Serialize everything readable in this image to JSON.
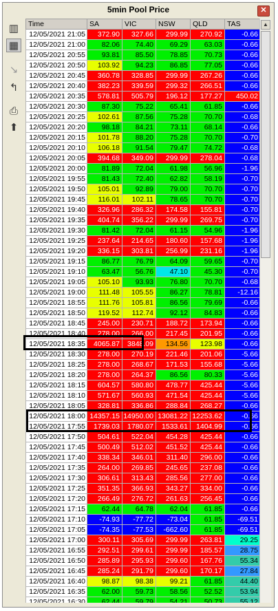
{
  "window": {
    "title": "5min Pool Price",
    "close_label": "✕"
  },
  "toolbar": {
    "items": [
      {
        "name": "chart-icon",
        "glyph": "▥"
      },
      {
        "name": "grid-icon",
        "glyph": "▦"
      },
      {
        "name": "export-icon",
        "glyph": "↘"
      },
      {
        "name": "return-icon",
        "glyph": "↰"
      },
      {
        "name": "printer-icon",
        "glyph": "⎙"
      },
      {
        "name": "paste-icon",
        "glyph": "⬆"
      }
    ]
  },
  "table": {
    "headers": [
      "Time",
      "SA",
      "VIC",
      "NSW",
      "QLD",
      "TAS"
    ],
    "rows": [
      [
        "12/05/2021 21:05",
        "372.90",
        "327.66",
        "299.99",
        "270.92",
        "-0.66"
      ],
      [
        "12/05/2021 21:00",
        "82.06",
        "74.40",
        "69.29",
        "63.03",
        "-0.66"
      ],
      [
        "12/05/2021 20:55",
        "93.81",
        "85.50",
        "78.85",
        "70.73",
        "-0.66"
      ],
      [
        "12/05/2021 20:50",
        "103.92",
        "94.23",
        "86.85",
        "77.05",
        "-0.66"
      ],
      [
        "12/05/2021 20:45",
        "360.78",
        "328.85",
        "299.99",
        "267.26",
        "-0.66"
      ],
      [
        "12/05/2021 20:40",
        "382.23",
        "339.59",
        "299.32",
        "266.51",
        "-0.66"
      ],
      [
        "12/05/2021 20:35",
        "578.81",
        "505.79",
        "196.12",
        "177.27",
        "450.02"
      ],
      [
        "12/05/2021 20:30",
        "87.30",
        "75.22",
        "65.41",
        "61.85",
        "-0.66"
      ],
      [
        "12/05/2021 20:25",
        "102.61",
        "87.56",
        "75.28",
        "70.70",
        "-0.68"
      ],
      [
        "12/05/2021 20:20",
        "98.18",
        "84.21",
        "73.11",
        "68.14",
        "-0.66"
      ],
      [
        "12/05/2021 20:15",
        "101.78",
        "88.20",
        "75.28",
        "70.70",
        "-0.70"
      ],
      [
        "12/05/2021 20:10",
        "106.18",
        "91.54",
        "79.47",
        "74.72",
        "-0.68"
      ],
      [
        "12/05/2021 20:05",
        "394.68",
        "349.09",
        "299.99",
        "278.04",
        "-0.68"
      ],
      [
        "12/05/2021 20:00",
        "81.89",
        "72.04",
        "61.98",
        "56.96",
        "-1.96"
      ],
      [
        "12/05/2021 19:55",
        "81.43",
        "72.40",
        "62.82",
        "58.19",
        "-0.70"
      ],
      [
        "12/05/2021 19:50",
        "105.01",
        "92.89",
        "79.00",
        "70.70",
        "-0.70"
      ],
      [
        "12/05/2021 19:45",
        "116.01",
        "102.11",
        "78.65",
        "70.70",
        "-0.70"
      ],
      [
        "12/05/2021 19:40",
        "326.96",
        "286.32",
        "174.58",
        "155.81",
        "-0.70"
      ],
      [
        "12/05/2021 19:35",
        "404.74",
        "356.22",
        "299.99",
        "269.75",
        "-0.70"
      ],
      [
        "12/05/2021 19:30",
        "81.42",
        "72.04",
        "61.15",
        "54.96",
        "-1.96"
      ],
      [
        "12/05/2021 19:25",
        "237.64",
        "214.65",
        "180.60",
        "157.68",
        "-1.96"
      ],
      [
        "12/05/2021 19:20",
        "336.15",
        "303.81",
        "256.99",
        "231.16",
        "-1.96"
      ],
      [
        "12/05/2021 19:15",
        "86.77",
        "76.79",
        "64.09",
        "59.65",
        "-0.70"
      ],
      [
        "12/05/2021 19:10",
        "63.47",
        "56.76",
        "47.10",
        "45.30",
        "-0.70"
      ],
      [
        "12/05/2021 19:05",
        "105.10",
        "93.93",
        "76.80",
        "70.70",
        "-0.68"
      ],
      [
        "12/05/2021 19:00",
        "111.48",
        "105.55",
        "86.27",
        "78.81",
        "-12.16"
      ],
      [
        "12/05/2021 18:55",
        "111.76",
        "105.81",
        "86.56",
        "79.69",
        "-0.66"
      ],
      [
        "12/05/2021 18:50",
        "119.52",
        "112.74",
        "92.12",
        "84.83",
        "-0.66"
      ],
      [
        "12/05/2021 18:45",
        "245.00",
        "230.71",
        "188.72",
        "173.94",
        "-0.66"
      ],
      [
        "12/05/2021 18:40",
        "278.00",
        "266.00",
        "217.45",
        "201.95",
        "-0.66"
      ],
      [
        "12/05/2021 18:35",
        "4065.87",
        "3848.09",
        "134.56",
        "123.98",
        "-0.66"
      ],
      [
        "12/05/2021 18:30",
        "278.00",
        "270.19",
        "221.46",
        "201.06",
        "-5.66"
      ],
      [
        "12/05/2021 18:25",
        "278.00",
        "268.67",
        "171.53",
        "155.68",
        "-5.66"
      ],
      [
        "12/05/2021 18:20",
        "278.00",
        "264.37",
        "86.56",
        "80.33",
        "-5.66"
      ],
      [
        "12/05/2021 18:15",
        "604.57",
        "580.80",
        "478.77",
        "425.44",
        "-5.66"
      ],
      [
        "12/05/2021 18:10",
        "571.67",
        "560.93",
        "471.54",
        "425.44",
        "-5.66"
      ],
      [
        "12/05/2021 18:05",
        "328.81",
        "336.86",
        "288.84",
        "268.27",
        "-0.66"
      ],
      [
        "12/05/2021 18:00",
        "14357.15",
        "14950.00",
        "13081.22",
        "12253.62",
        "-0.66"
      ],
      [
        "12/05/2021 17:55",
        "1739.03",
        "1780.07",
        "1533.61",
        "1404.99",
        "-0.66"
      ],
      [
        "12/05/2021 17:50",
        "504.61",
        "522.04",
        "454.28",
        "425.44",
        "-0.66"
      ],
      [
        "12/05/2021 17:45",
        "500.49",
        "512.02",
        "451.52",
        "425.44",
        "-0.66"
      ],
      [
        "12/05/2021 17:40",
        "338.34",
        "346.01",
        "311.40",
        "296.00",
        "-0.66"
      ],
      [
        "12/05/2021 17:35",
        "264.00",
        "269.85",
        "245.65",
        "237.08",
        "-0.66"
      ],
      [
        "12/05/2021 17:30",
        "306.61",
        "313.43",
        "285.56",
        "277.00",
        "-0.66"
      ],
      [
        "12/05/2021 17:25",
        "351.35",
        "366.93",
        "343.27",
        "334.00",
        "-0.66"
      ],
      [
        "12/05/2021 17:20",
        "266.49",
        "276.72",
        "261.63",
        "256.45",
        "-0.66"
      ],
      [
        "12/05/2021 17:15",
        "62.44",
        "64.78",
        "62.04",
        "61.85",
        "-0.66"
      ],
      [
        "12/05/2021 17:10",
        "-74.93",
        "-77.72",
        "-73.04",
        "61.85",
        "-69.51"
      ],
      [
        "12/05/2021 17:05",
        "-74.35",
        "-77.53",
        "-662.60",
        "61.85",
        "-69.51"
      ],
      [
        "12/05/2021 17:00",
        "300.11",
        "305.69",
        "299.99",
        "263.81",
        "29.25"
      ],
      [
        "12/05/2021 16:55",
        "292.51",
        "299.61",
        "299.99",
        "185.57",
        "28.75"
      ],
      [
        "12/05/2021 16:50",
        "285.89",
        "295.93",
        "299.60",
        "167.76",
        "55.34"
      ],
      [
        "12/05/2021 16:45",
        "285.24",
        "291.79",
        "299.60",
        "170.17",
        "27.84"
      ],
      [
        "12/05/2021 16:40",
        "98.87",
        "98.38",
        "99.21",
        "61.85",
        "44.40"
      ],
      [
        "12/05/2021 16:35",
        "62.00",
        "59.73",
        "58.56",
        "52.52",
        "53.94"
      ],
      [
        "12/05/2021 16:30",
        "62.44",
        "59.79",
        "54.21",
        "50.73",
        "55.12"
      ]
    ],
    "colors": [
      [
        "red",
        "red",
        "red",
        "red",
        "blue"
      ],
      [
        "green",
        "green",
        "green",
        "green",
        "blue"
      ],
      [
        "green",
        "green",
        "green",
        "green",
        "blue"
      ],
      [
        "yellow",
        "green",
        "green",
        "green",
        "blue"
      ],
      [
        "red",
        "red",
        "red",
        "red",
        "blue"
      ],
      [
        "red",
        "red",
        "red",
        "red",
        "blue"
      ],
      [
        "red",
        "red",
        "red",
        "red",
        "red"
      ],
      [
        "green",
        "green",
        "green",
        "green",
        "blue"
      ],
      [
        "yellow",
        "green",
        "green",
        "green",
        "blue"
      ],
      [
        "green",
        "green",
        "green",
        "green",
        "blue"
      ],
      [
        "yellow",
        "green",
        "green",
        "green",
        "blue"
      ],
      [
        "yellow",
        "green",
        "green",
        "green",
        "blue"
      ],
      [
        "red",
        "red",
        "red",
        "red",
        "blue"
      ],
      [
        "green",
        "green",
        "green",
        "green",
        "blue"
      ],
      [
        "green",
        "green",
        "green",
        "green",
        "blue"
      ],
      [
        "yellow",
        "green",
        "green",
        "green",
        "blue"
      ],
      [
        "yellow",
        "yellow",
        "green",
        "green",
        "blue"
      ],
      [
        "red",
        "red",
        "red",
        "red",
        "blue"
      ],
      [
        "red",
        "red",
        "red",
        "red",
        "blue"
      ],
      [
        "green",
        "green",
        "green",
        "green",
        "blue"
      ],
      [
        "red",
        "red",
        "red",
        "red",
        "blue"
      ],
      [
        "red",
        "red",
        "red",
        "red",
        "blue"
      ],
      [
        "green",
        "green",
        "green",
        "green",
        "blue"
      ],
      [
        "green",
        "green",
        "cyan",
        "green",
        "blue"
      ],
      [
        "yellow",
        "green",
        "green",
        "green",
        "blue"
      ],
      [
        "yellow",
        "yellow",
        "green",
        "green",
        "blue"
      ],
      [
        "yellow",
        "yellow",
        "green",
        "green",
        "blue"
      ],
      [
        "yellow",
        "yellow",
        "green",
        "green",
        "blue"
      ],
      [
        "red",
        "red",
        "red",
        "red",
        "blue"
      ],
      [
        "red",
        "red",
        "red",
        "red",
        "blue"
      ],
      [
        "red",
        "red",
        "orange",
        "yellow",
        "blue"
      ],
      [
        "red",
        "red",
        "red",
        "red",
        "blue"
      ],
      [
        "red",
        "red",
        "red",
        "red",
        "blue"
      ],
      [
        "red",
        "red",
        "green",
        "green",
        "blue"
      ],
      [
        "red",
        "red",
        "red",
        "red",
        "blue"
      ],
      [
        "red",
        "red",
        "red",
        "red",
        "blue"
      ],
      [
        "red",
        "red",
        "red",
        "red",
        "blue"
      ],
      [
        "red",
        "red",
        "red",
        "red",
        "blue"
      ],
      [
        "red",
        "red",
        "red",
        "red",
        "blue"
      ],
      [
        "red",
        "red",
        "red",
        "red",
        "blue"
      ],
      [
        "red",
        "red",
        "red",
        "red",
        "blue"
      ],
      [
        "red",
        "red",
        "red",
        "red",
        "blue"
      ],
      [
        "red",
        "red",
        "red",
        "red",
        "blue"
      ],
      [
        "red",
        "red",
        "red",
        "red",
        "blue"
      ],
      [
        "red",
        "red",
        "red",
        "red",
        "blue"
      ],
      [
        "red",
        "red",
        "red",
        "red",
        "blue"
      ],
      [
        "green",
        "green",
        "green",
        "green",
        "blue"
      ],
      [
        "blue",
        "blue",
        "blue",
        "green",
        "blue"
      ],
      [
        "blue",
        "blue",
        "blue",
        "green",
        "blue"
      ],
      [
        "red",
        "red",
        "red",
        "red",
        "lteal"
      ],
      [
        "red",
        "red",
        "red",
        "red",
        "ltblue"
      ],
      [
        "red",
        "red",
        "red",
        "red",
        "teal"
      ],
      [
        "red",
        "red",
        "red",
        "red",
        "ltblue"
      ],
      [
        "yellow",
        "yellow",
        "yellow",
        "green",
        "teal"
      ],
      [
        "green",
        "green",
        "green",
        "green",
        "teal"
      ],
      [
        "green",
        "green",
        "green",
        "green",
        "teal"
      ]
    ]
  }
}
